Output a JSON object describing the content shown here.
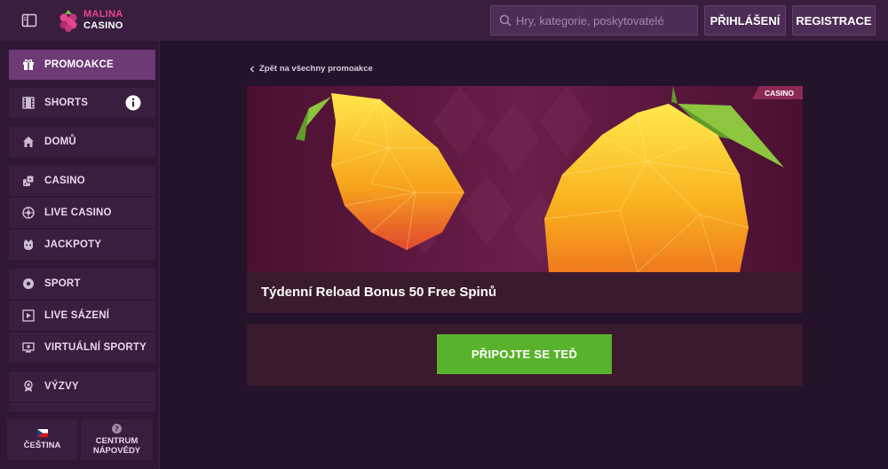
{
  "header": {
    "logo_line1": "MALINA",
    "logo_line2": "CASINO",
    "search_placeholder": "Hry, kategorie, poskytovatelé",
    "login_label": "PŘIHLÁŠENÍ",
    "register_label": "REGISTRACE"
  },
  "sidebar": {
    "items": [
      {
        "label": "PROMOAKCE",
        "icon": "gift-icon",
        "active": true
      },
      {
        "label": "SHORTS",
        "icon": "film-icon"
      },
      {
        "label": "DOMŮ",
        "icon": "home-icon"
      },
      {
        "label": "CASINO",
        "icon": "dice-icon"
      },
      {
        "label": "LIVE CASINO",
        "icon": "roulette-icon"
      },
      {
        "label": "JACKPOTY",
        "icon": "jackpot-icon"
      },
      {
        "label": "SPORT",
        "icon": "soccer-ball-icon"
      },
      {
        "label": "LIVE SÁZENÍ",
        "icon": "live-play-icon"
      },
      {
        "label": "VIRTUÁLNÍ SPORTY",
        "icon": "monitor-icon"
      },
      {
        "label": "VÝZVY",
        "icon": "medal-icon"
      }
    ],
    "footer": {
      "language_label": "ČEŠTINA",
      "help_line1": "CENTRUM",
      "help_line2": "NÁPOVĚDY"
    }
  },
  "main": {
    "back_link": "Zpět na všechny promoakce",
    "badge": "CASINO",
    "promo_title": "Týdenní Reload Bonus 50 Free Spinů",
    "cta_label": "PŘIPOJTE SE TEĎ"
  },
  "colors": {
    "background": "#241329",
    "header": "#3a1e40",
    "active_nav": "#6d3a76",
    "brand_pink": "#e7468c",
    "cta_green": "#59b22b",
    "badge": "#8c2a55"
  }
}
